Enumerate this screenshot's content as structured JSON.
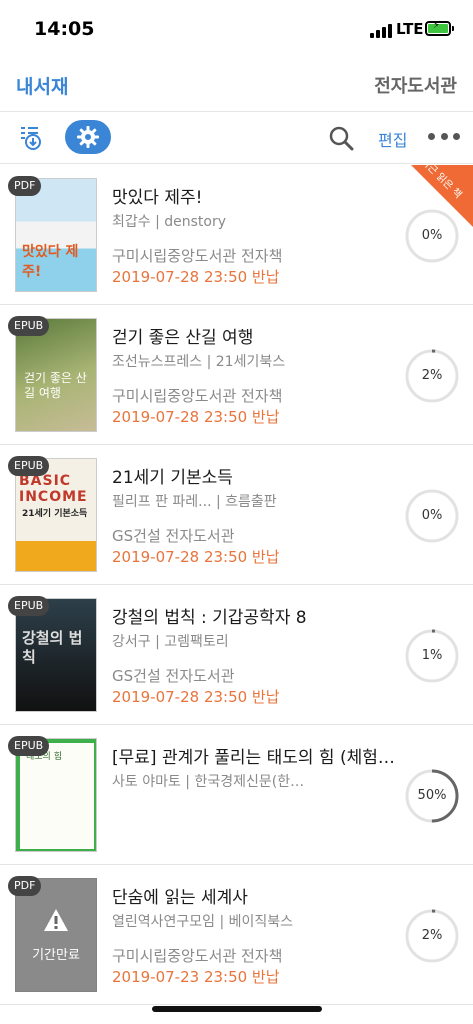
{
  "status": {
    "time": "14:05",
    "network": "LTE"
  },
  "nav": {
    "left": "내서재",
    "right": "전자도서관"
  },
  "toolbar": {
    "edit": "편집"
  },
  "ribbon": {
    "text": "최근 읽은 책"
  },
  "expired_label": "기간만료",
  "books": [
    {
      "format": "PDF",
      "title": "맛있다 제주!",
      "meta": "최갑수 | denstory",
      "library": "구미시립중앙도서관 전자책",
      "due": "2019-07-28 23:50 반납",
      "progress_label": "0%",
      "progress": 0,
      "cover_text": "맛있다 제주!"
    },
    {
      "format": "EPUB",
      "title": "걷기 좋은 산길 여행",
      "meta": "조선뉴스프레스 | 21세기북스",
      "library": "구미시립중앙도서관 전자책",
      "due": "2019-07-28 23:50 반납",
      "progress_label": "2%",
      "progress": 0.02,
      "cover_text": "걷기 좋은 산길 여행"
    },
    {
      "format": "EPUB",
      "title": "21세기 기본소득",
      "meta": "필리프 판 파레... | 흐름출판",
      "library": "GS건설 전자도서관",
      "due": "2019-07-28 23:50 반납",
      "progress_label": "0%",
      "progress": 0,
      "cover_text": "BASIC INCOME",
      "cover_sub": "21세기 기본소득"
    },
    {
      "format": "EPUB",
      "title": "강철의 법칙 : 기갑공학자 8",
      "meta": "강서구 | 고렘팩토리",
      "library": "GS건설 전자도서관",
      "due": "2019-07-28 23:50 반납",
      "progress_label": "1%",
      "progress": 0.01,
      "cover_text": "강철의 법칙"
    },
    {
      "format": "EPUB",
      "title": "[무료] 관계가 풀리는 태도의 힘 (체험…",
      "meta": "사토 야마토 | 한국경제신문(한…",
      "library": "",
      "due": "",
      "progress_label": "50%",
      "progress": 0.5,
      "cover_text": "태도의 힘"
    },
    {
      "format": "PDF",
      "title": "단숨에 읽는 세계사",
      "meta": "열린역사연구모임 | 베이직북스",
      "library": "구미시립중앙도서관 전자책",
      "due": "2019-07-23 23:50 반납",
      "progress_label": "2%",
      "progress": 0.02,
      "cover_text": ""
    }
  ],
  "colors": {
    "accent": "#3a85d6",
    "due": "#e8743c",
    "ribbon": "#ef6a34"
  }
}
